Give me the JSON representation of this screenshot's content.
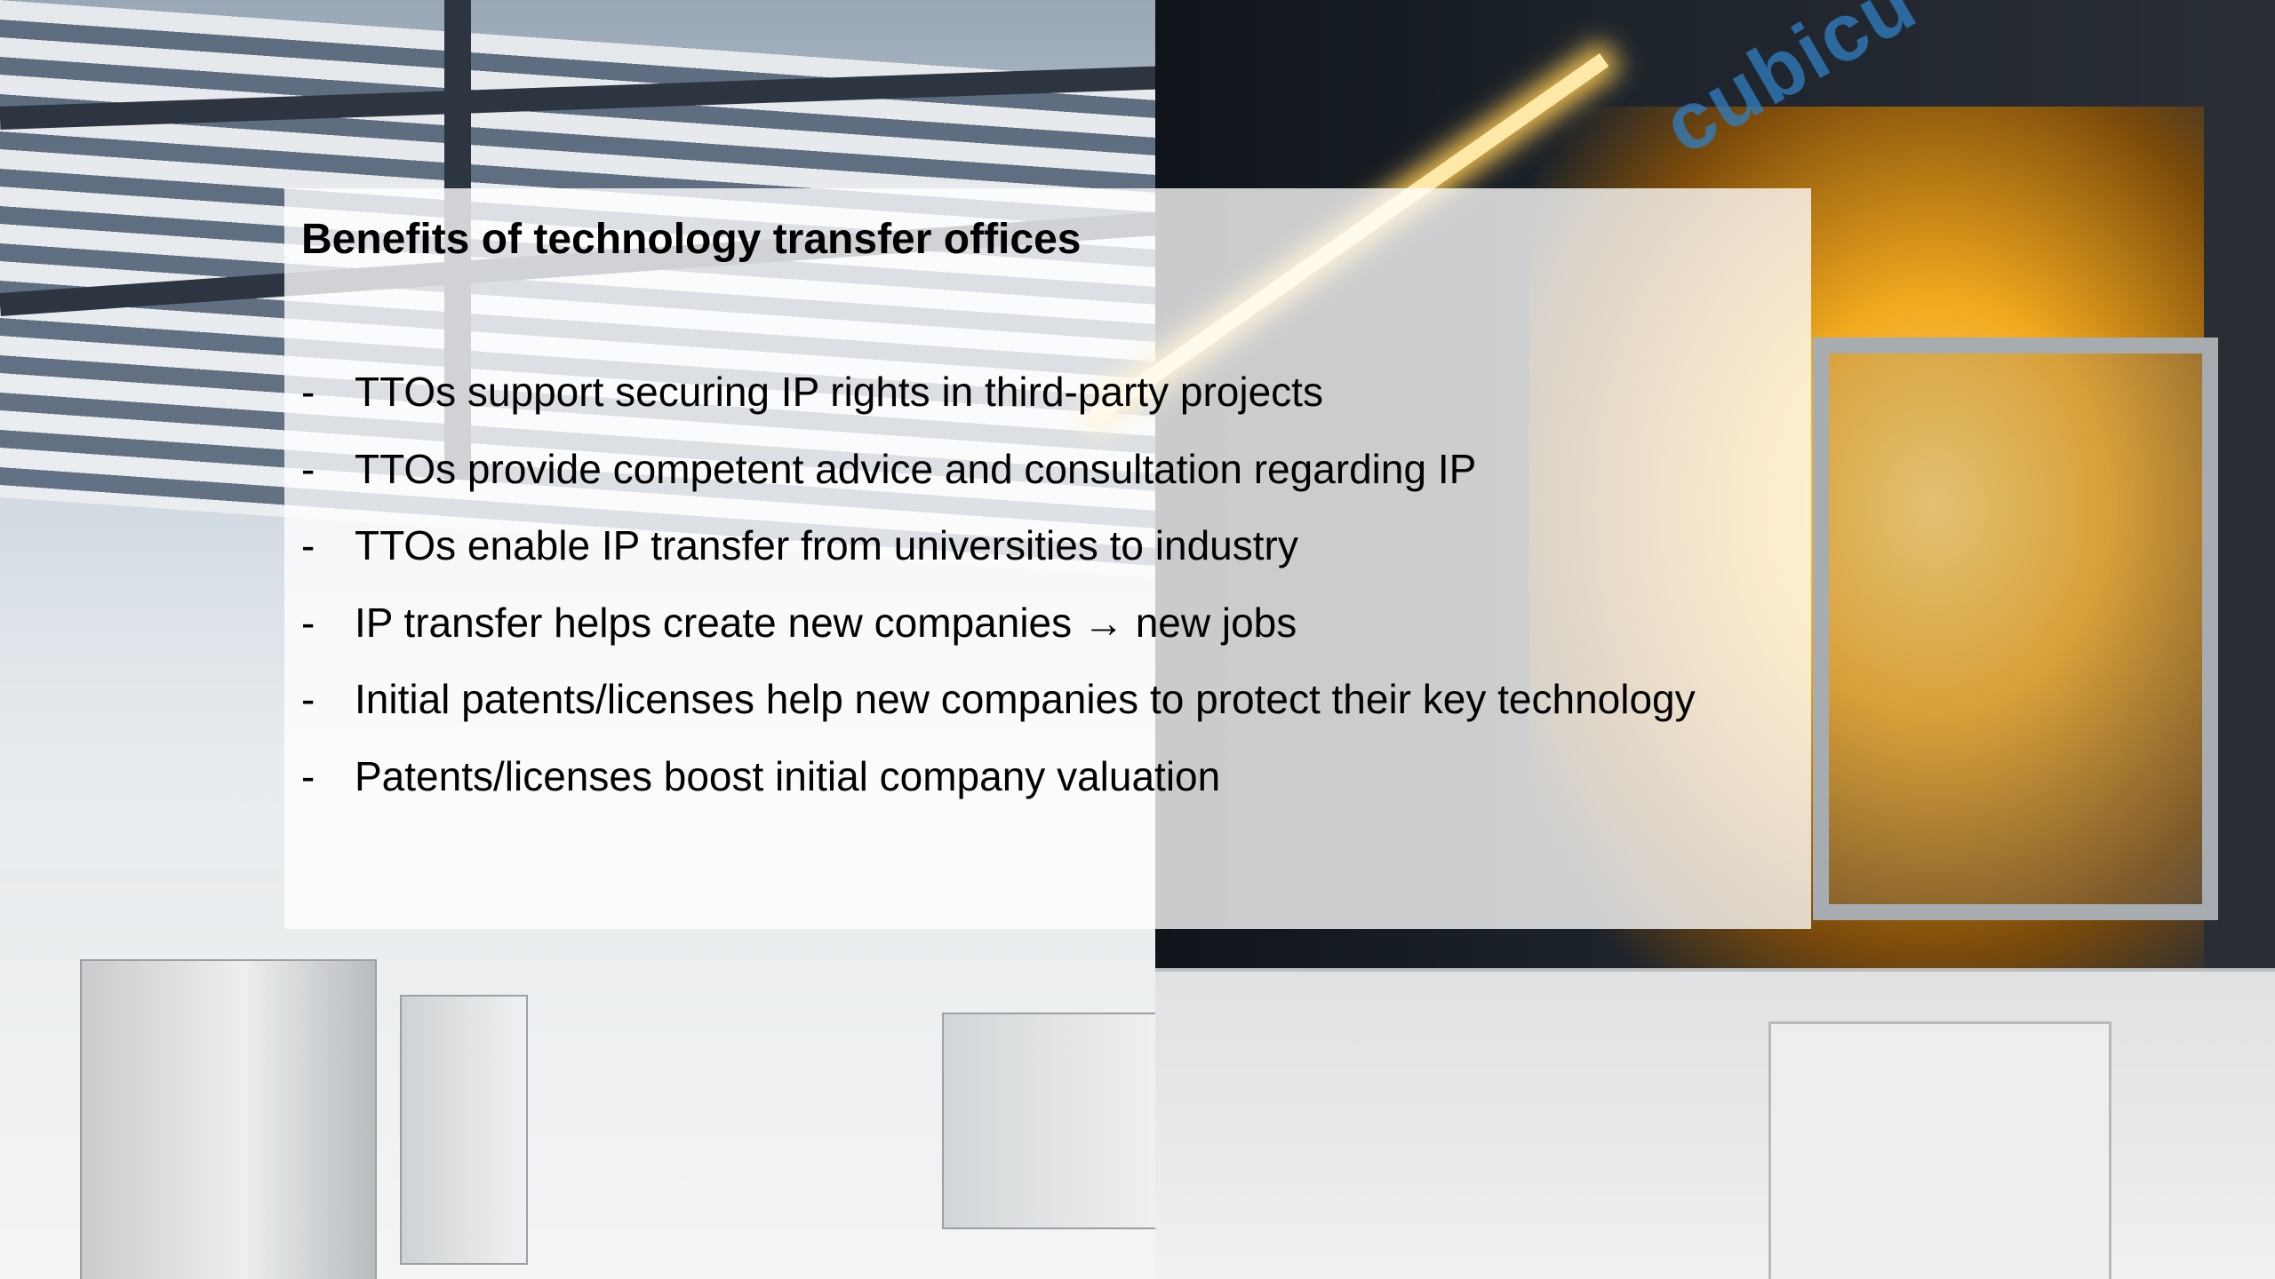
{
  "slide": {
    "title": "Benefits of technology transfer offices",
    "bullets": [
      {
        "marker": "-",
        "text": "TTOs support securing IP rights in third-party projects"
      },
      {
        "marker": "-",
        "text": "TTOs provide competent advice and consultation regarding IP"
      },
      {
        "marker": "-",
        "text": "TTOs enable IP transfer from universities to industry"
      },
      {
        "marker": "-",
        "text": "IP transfer helps create new companies → new jobs"
      },
      {
        "marker": "-",
        "text": "Initial patents/licenses help new companies to protect their key technology"
      },
      {
        "marker": "-",
        "text": "Patents/licenses boost initial company valuation"
      }
    ]
  },
  "background": {
    "machine_logo_text": "cubicu"
  },
  "colors": {
    "panel": "#ffffff",
    "text": "#000000",
    "accent_glow": "#f2a91f",
    "logo_blue": "#2f7fc4"
  }
}
